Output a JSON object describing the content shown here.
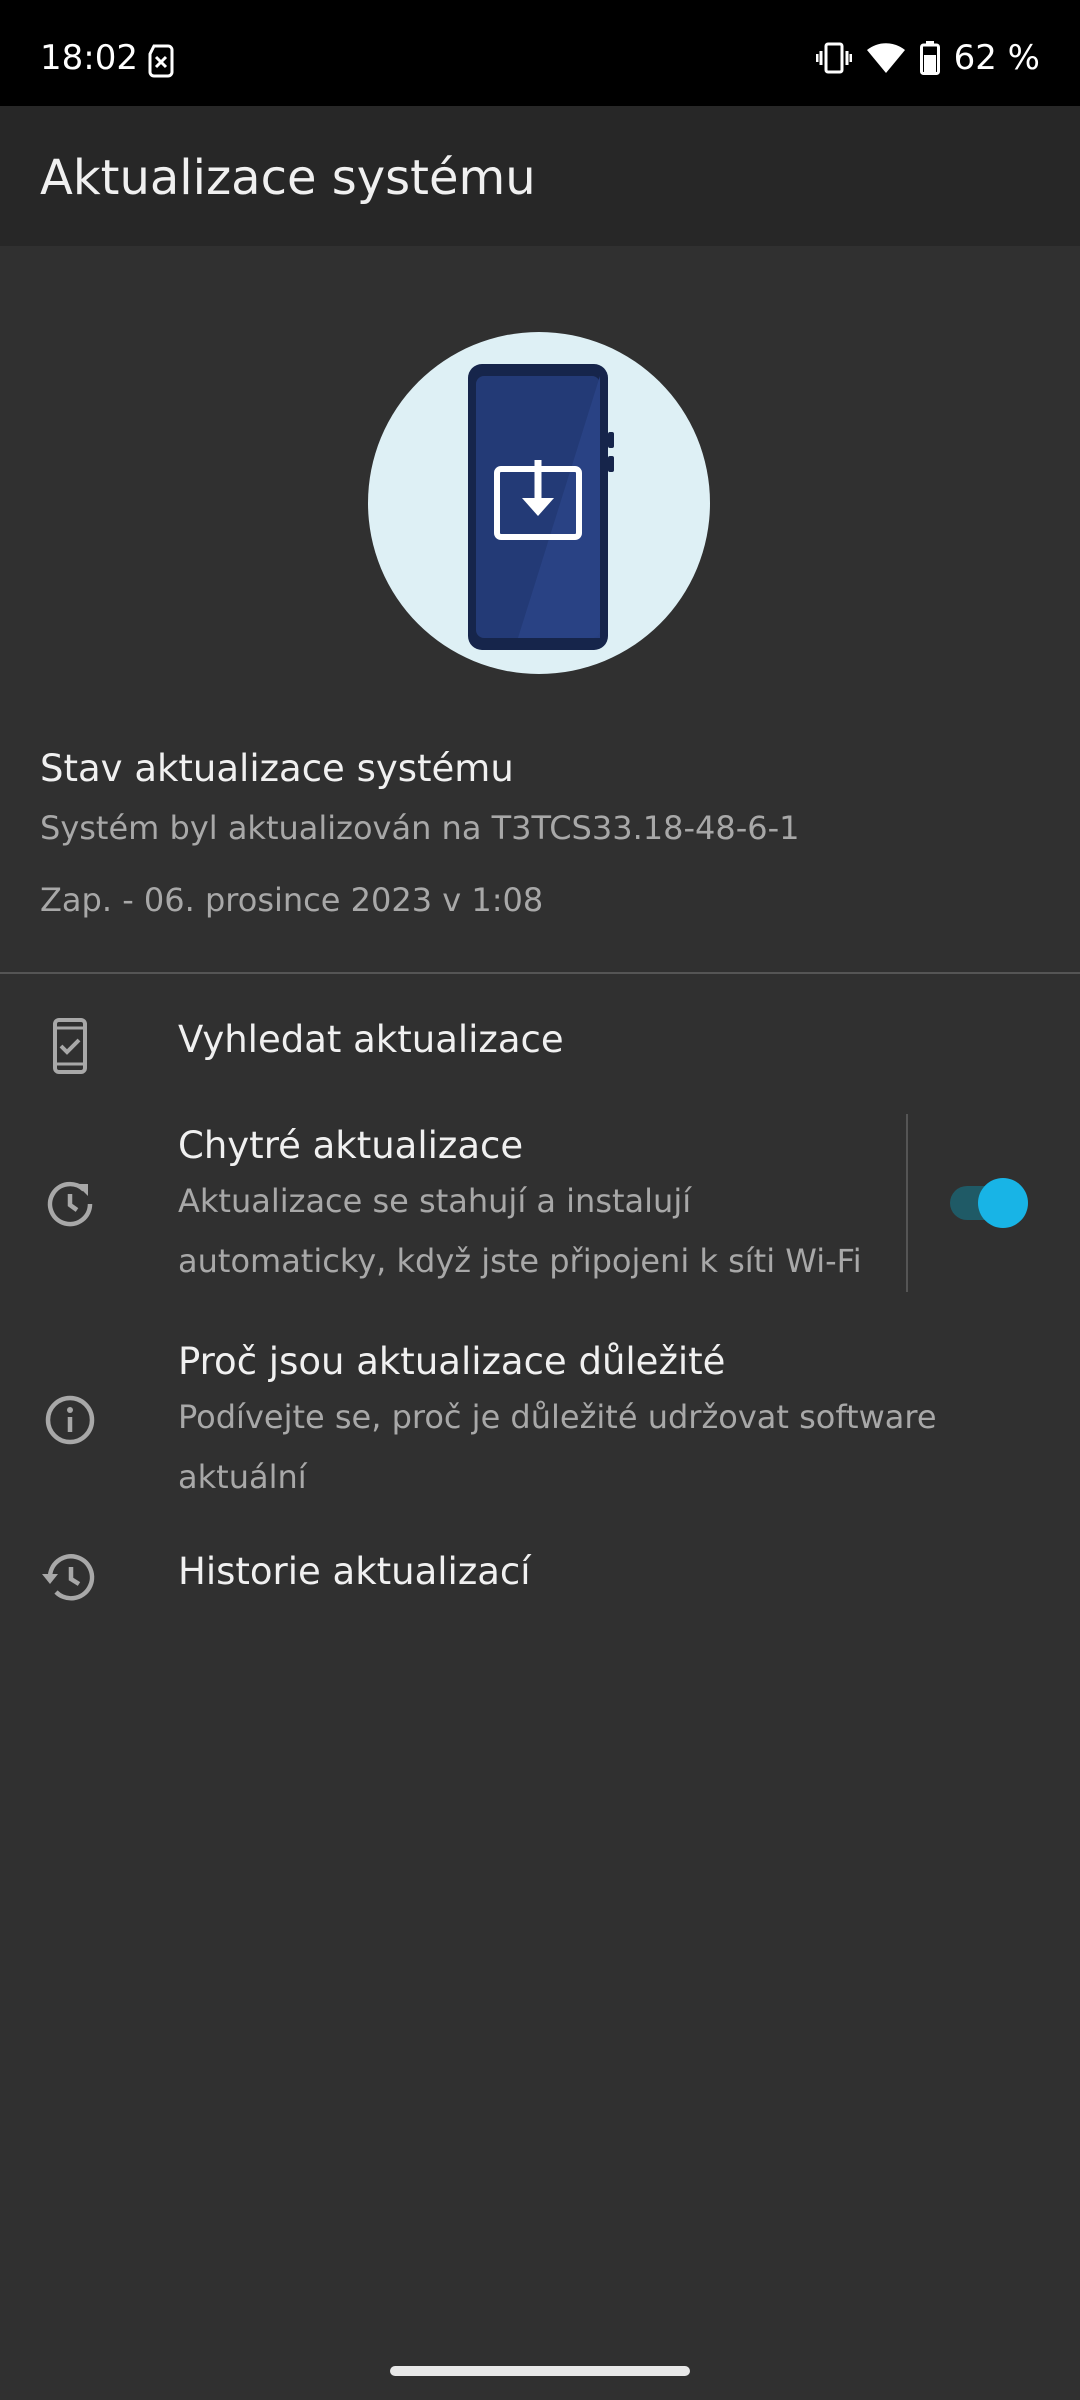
{
  "status_bar": {
    "time": "18:02",
    "battery_text": "62 %",
    "icons": [
      "sim-card-alert-icon",
      "vibrate-icon",
      "wifi-icon",
      "battery-icon"
    ]
  },
  "app_bar": {
    "title": "Aktualizace systému"
  },
  "hero": {
    "icon": "phone-download-illustration"
  },
  "update_status": {
    "title": "Stav aktualizace systému",
    "line1": "Systém byl aktualizován na T3TCS33.18-48-6-1",
    "line2": "Zap. - 06. prosince 2023 v 1:08"
  },
  "rows": {
    "check": {
      "title": "Vyhledat aktualizace",
      "icon": "phone-check-icon"
    },
    "smart": {
      "title": "Chytré aktualizace",
      "sub1": "Aktualizace se stahují a instalují",
      "sub2": "automaticky, když jste připojeni k síti Wi-Fi",
      "icon": "schedule-refresh-icon",
      "toggle_on": true
    },
    "why": {
      "title": "Proč jsou aktualizace důležité",
      "sub1": "Podívejte se, proč je důležité udržovat software",
      "sub2": "aktuální",
      "icon": "info-icon"
    },
    "history": {
      "title": "Historie aktualizací",
      "icon": "history-icon"
    }
  },
  "colors": {
    "background": "#303030",
    "app_bar": "#272727",
    "status_bar": "#000000",
    "accent": "#18b4e6",
    "hero_circle": "#def0f5",
    "phone_body": "#1e2f5e"
  }
}
